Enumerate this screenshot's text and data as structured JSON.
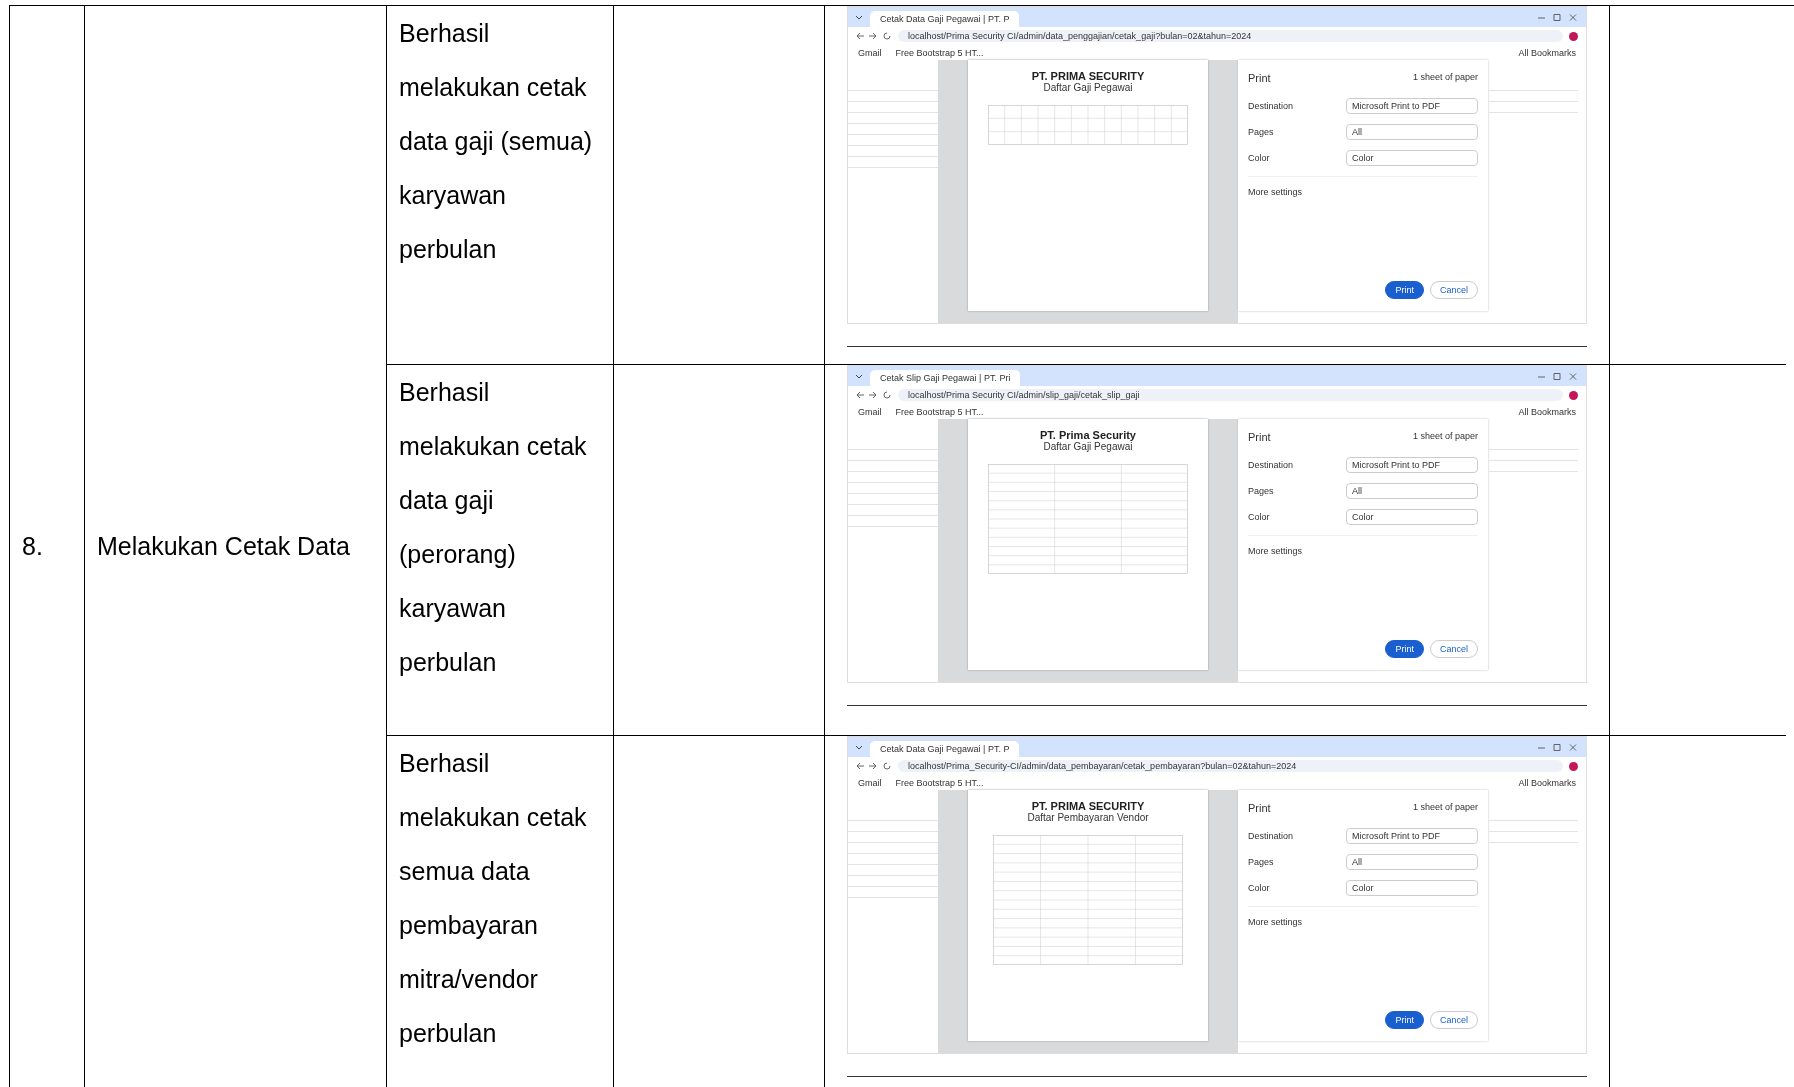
{
  "table": {
    "number": "8.",
    "activity": "Melakukan Cetak Data",
    "rows": [
      {
        "result": "Berhasil melakukan cetak data gaji (semua) karyawan perbulan",
        "screenshot": {
          "tab_title": "Cetak Data Gaji Pegawai | PT. P",
          "url": "localhost/Prima Security CI/admin/data_penggajian/cetak_gaji?bulan=02&tahun=2024",
          "bookmarks": [
            "Gmail",
            "Free Bootstrap 5 HT..."
          ],
          "all_bookmarks": "All Bookmarks",
          "document": {
            "kind": "wide-table",
            "title": "PT. PRIMA SECURITY",
            "subtitle": "Daftar Gaji Pegawai"
          },
          "print": {
            "title": "Print",
            "sheets": "1 sheet of paper",
            "fields": [
              {
                "label": "Destination",
                "value": "Microsoft Print to PDF"
              },
              {
                "label": "Pages",
                "value": "All"
              },
              {
                "label": "Color",
                "value": "Color"
              }
            ],
            "more": "More settings",
            "buttons": [
              "Print",
              "Cancel"
            ]
          }
        }
      },
      {
        "result": "Berhasil melakukan cetak data gaji (perorang) karyawan perbulan",
        "screenshot": {
          "tab_title": "Cetak Slip Gaji Pegawai | PT. Pri",
          "url": "localhost/Prima Security CI/admin/slip_gaji/cetak_slip_gaji",
          "bookmarks": [
            "Gmail",
            "Free Bootstrap 5 HT..."
          ],
          "all_bookmarks": "All Bookmarks",
          "document": {
            "kind": "slip",
            "title": "PT. Prima Security",
            "subtitle": "Daftar Gaji Pegawai"
          },
          "print": {
            "title": "Print",
            "sheets": "1 sheet of paper",
            "fields": [
              {
                "label": "Destination",
                "value": "Microsoft Print to PDF"
              },
              {
                "label": "Pages",
                "value": "All"
              },
              {
                "label": "Color",
                "value": "Color"
              }
            ],
            "more": "More settings",
            "buttons": [
              "Print",
              "Cancel"
            ]
          }
        }
      },
      {
        "result": "Berhasil melakukan cetak semua data pembayaran mitra/vendor perbulan",
        "screenshot": {
          "tab_title": "Cetak Data Gaji Pegawai | PT. P",
          "url": "localhost/Prima_Security-CI/admin/data_pembayaran/cetak_pembayaran?bulan=02&tahun=2024",
          "bookmarks": [
            "Gmail",
            "Free Bootstrap 5 HT..."
          ],
          "all_bookmarks": "All Bookmarks",
          "document": {
            "kind": "vendor-table",
            "title": "PT. PRIMA SECURITY",
            "subtitle": "Daftar Pembayaran Vendor"
          },
          "print": {
            "title": "Print",
            "sheets": "1 sheet of paper",
            "fields": [
              {
                "label": "Destination",
                "value": "Microsoft Print to PDF"
              },
              {
                "label": "Pages",
                "value": "All"
              },
              {
                "label": "Color",
                "value": "Color"
              }
            ],
            "more": "More settings",
            "buttons": [
              "Print",
              "Cancel"
            ]
          }
        }
      }
    ]
  }
}
